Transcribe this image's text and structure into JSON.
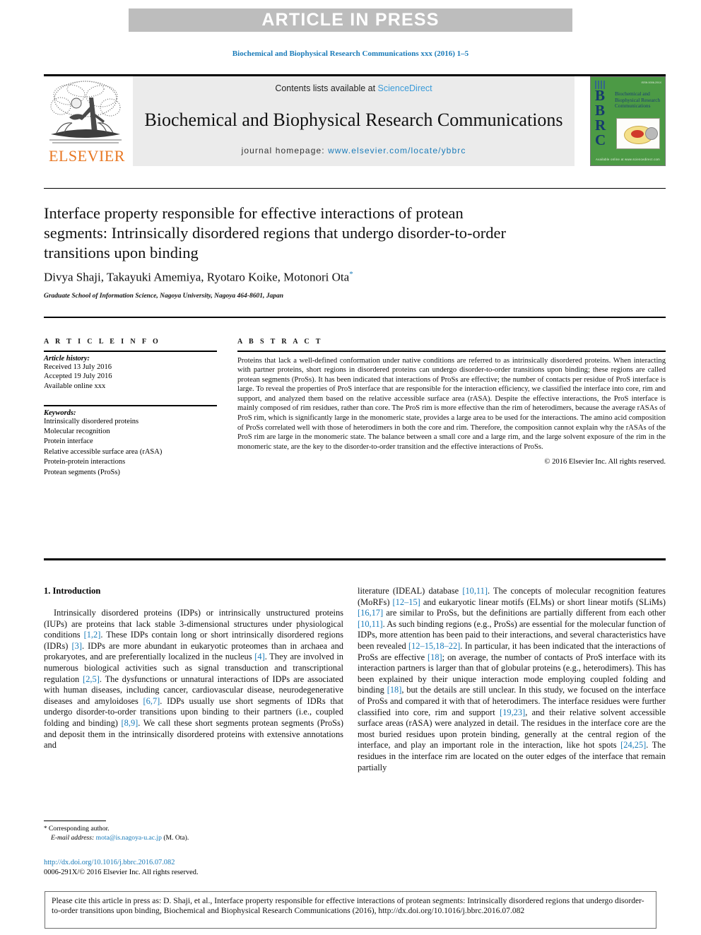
{
  "banner": {
    "text": "ARTICLE IN PRESS"
  },
  "running_head": "Biochemical and Biophysical Research Communications xxx (2016) 1–5",
  "masthead": {
    "contents_prefix": "Contents lists available at ",
    "contents_link": "ScienceDirect",
    "journal_title": "Biochemical and Biophysical Research Communications",
    "homepage_prefix": "journal homepage: ",
    "homepage_link": "www.elsevier.com/locate/ybbrc",
    "publisher": "ELSEVIER",
    "cover": {
      "letters": "B\nB\nR\nC",
      "title": "Biochemical and Biophysical Research Communications",
      "topright": "ISSN 0006-291X",
      "footer": "Available online at www.sciencedirect.com"
    }
  },
  "article": {
    "title": "Interface property responsible for effective interactions of protean segments: Intrinsically disordered regions that undergo disorder-to-order transitions upon binding",
    "authors": "Divya Shaji, Takayuki Amemiya, Ryotaro Koike, Motonori Ota",
    "corresponding_marker": "*",
    "affiliation": "Graduate School of Information Science, Nagoya University, Nagoya 464-8601, Japan"
  },
  "info": {
    "heading": "A R T I C L E   I N F O",
    "history_label": "Article history:",
    "history": [
      "Received 13 July 2016",
      "Accepted 19 July 2016",
      "Available online xxx"
    ],
    "keywords_label": "Keywords:",
    "keywords": [
      "Intrinsically disordered proteins",
      "Molecular recognition",
      "Protein interface",
      "Relative accessible surface area (rASA)",
      "Protein-protein interactions",
      "Protean segments (ProSs)"
    ]
  },
  "abstract": {
    "heading": "A B S T R A C T",
    "body": "Proteins that lack a well-defined conformation under native conditions are referred to as intrinsically disordered proteins. When interacting with partner proteins, short regions in disordered proteins can undergo disorder-to-order transitions upon binding; these regions are called protean segments (ProSs). It has been indicated that interactions of ProSs are effective; the number of contacts per residue of ProS interface is large. To reveal the properties of ProS interface that are responsible for the interaction efficiency, we classified the interface into core, rim and support, and analyzed them based on the relative accessible surface area (rASA). Despite the effective interactions, the ProS interface is mainly composed of rim residues, rather than core. The ProS rim is more effective than the rim of heterodimers, because the average rASAs of ProS rim, which is significantly large in the monomeric state, provides a large area to be used for the interactions. The amino acid composition of ProSs correlated well with those of heterodimers in both the core and rim. Therefore, the composition cannot explain why the rASAs of the ProS rim are large in the monomeric state. The balance between a small core and a large rim, and the large solvent exposure of the rim in the monomeric state, are the key to the disorder-to-order transition and the effective interactions of ProSs.",
    "copyright": "© 2016 Elsevier Inc. All rights reserved."
  },
  "body": {
    "section_number_title": "1.  Introduction",
    "left_paragraph_html": "Intrinsically disordered proteins (IDPs) or intrinsically unstructured proteins (IUPs) are proteins that lack stable 3-dimensional structures under physiological conditions [1,2]. These IDPs contain long or short intrinsically disordered regions (IDRs) [3]. IDPs are more abundant in eukaryotic proteomes than in archaea and prokaryotes, and are preferentially localized in the nucleus [4]. They are involved in numerous biological activities such as signal transduction and transcriptional regulation [2,5]. The dysfunctions or unnatural interactions of IDPs are associated with human diseases, including cancer, cardiovascular disease, neurodegenerative diseases and amyloidoses [6,7]. IDPs usually use short segments of IDRs that undergo disorder-to-order transitions upon binding to their partners (i.e., coupled folding and binding) [8,9]. We call these short segments protean segments (ProSs) and deposit them in the intrinsically disordered proteins with extensive annotations and",
    "right_paragraph_html": "literature (IDEAL) database [10,11]. The concepts of molecular recognition features (MoRFs) [12–15] and eukaryotic linear motifs (ELMs) or short linear motifs (SLiMs) [16,17] are similar to ProSs, but the definitions are partially different from each other [10,11]. As such binding regions (e.g., ProSs) are essential for the molecular function of IDPs, more attention has been paid to their interactions, and several characteristics have been revealed [12–15,18–22]. In particular, it has been indicated that the interactions of ProSs are effective [18]; on average, the number of contacts of ProS interface with its interaction partners is larger than that of globular proteins (e.g., heterodimers). This has been explained by their unique interaction mode employing coupled folding and binding [18], but the details are still unclear. In this study, we focused on the interface of ProSs and compared it with that of heterodimers. The interface residues were further classified into core, rim and support [19,23], and their relative solvent accessible surface areas (rASA) were analyzed in detail. The residues in the interface core are the most buried residues upon protein binding, generally at the central region of the interface, and play an important role in the interaction, like hot spots [24,25]. The residues in the interface rim are located on the outer edges of the interface that remain partially"
  },
  "footnote": {
    "corresponding": "Corresponding author.",
    "email_label": "E-mail address:",
    "email": "mota@is.nagoya-u.ac.jp",
    "email_suffix": "(M. Ota)."
  },
  "doi_block": {
    "doi_url": "http://dx.doi.org/10.1016/j.bbrc.2016.07.082",
    "issn_line": "0006-291X/© 2016 Elsevier Inc. All rights reserved."
  },
  "citation_box": {
    "text": "Please cite this article in press as: D. Shaji, et al., Interface property responsible for effective interactions of protean segments: Intrinsically disordered regions that undergo disorder-to-order transitions upon binding, Biochemical and Biophysical Research Communications (2016), http://dx.doi.org/10.1016/j.bbrc.2016.07.082"
  },
  "colors": {
    "link": "#1a7bb9",
    "sciencedirect": "#3a9bd9",
    "elsevier_orange": "#e87722",
    "banner_gray": "#bdbdbd",
    "masthead_gray": "#ebebeb",
    "cover_green": "#4c9a45"
  }
}
